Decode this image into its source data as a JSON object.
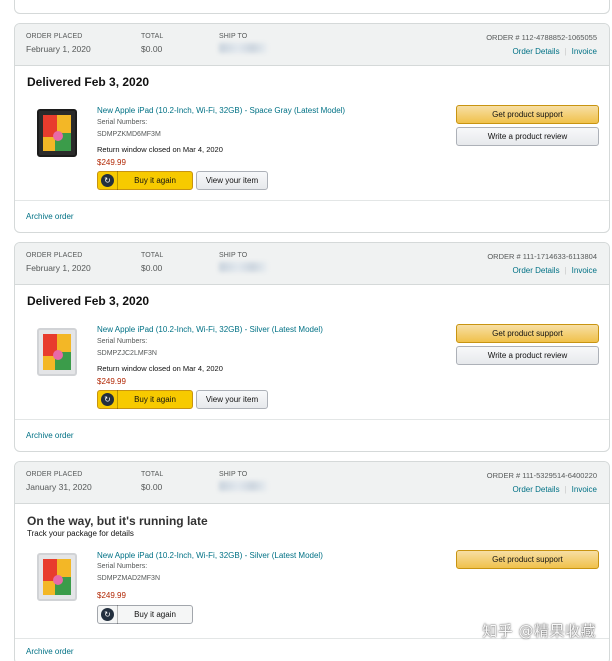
{
  "labels": {
    "order_placed": "ORDER PLACED",
    "total": "TOTAL",
    "ship_to": "SHIP TO",
    "order_details": "Order Details",
    "invoice": "Invoice",
    "serial_numbers": "Serial Numbers:",
    "buy_it_again": "Buy it again",
    "view_your_item": "View your item",
    "get_product_support": "Get product support",
    "write_review": "Write a product review",
    "archive_order": "Archive order"
  },
  "orders": [
    {
      "date": "February 1, 2020",
      "total": "$0.00",
      "order_number": "ORDER # 112-4788852-1065055",
      "status": "Delivered Feb 3, 2020",
      "product_title": "New Apple iPad (10.2-Inch, Wi-Fi, 32GB) - Space Gray (Latest Model)",
      "serial": "SDMPZKMD6MF3M",
      "return_window": "Return window closed on Mar 4, 2020",
      "price": "$249.99"
    },
    {
      "date": "February 1, 2020",
      "total": "$0.00",
      "order_number": "ORDER # 111-1714633-6113804",
      "status": "Delivered Feb 3, 2020",
      "product_title": "New Apple iPad (10.2-Inch, Wi-Fi, 32GB) - Silver (Latest Model)",
      "serial": "SDMPZJC2LMF3N",
      "return_window": "Return window closed on Mar 4, 2020",
      "price": "$249.99"
    },
    {
      "date": "January 31, 2020",
      "total": "$0.00",
      "order_number": "ORDER # 111-5329514-6400220",
      "status": "On the way, but it's running late",
      "status_sub": "Track your package for details",
      "product_title": "New Apple iPad (10.2-Inch, Wi-Fi, 32GB) - Silver (Latest Model)",
      "serial": "SDMPZMAD2MF3N",
      "price": "$249.99"
    }
  ],
  "icons": {
    "buy_again": "reorder-icon",
    "product": "ipad-thumbnail"
  },
  "colors": {
    "link": "#007185",
    "price": "#B12704",
    "primary_button": "#F0C14B",
    "header_bg": "#F0F2F2"
  },
  "watermark": "知乎 @精果收藏"
}
